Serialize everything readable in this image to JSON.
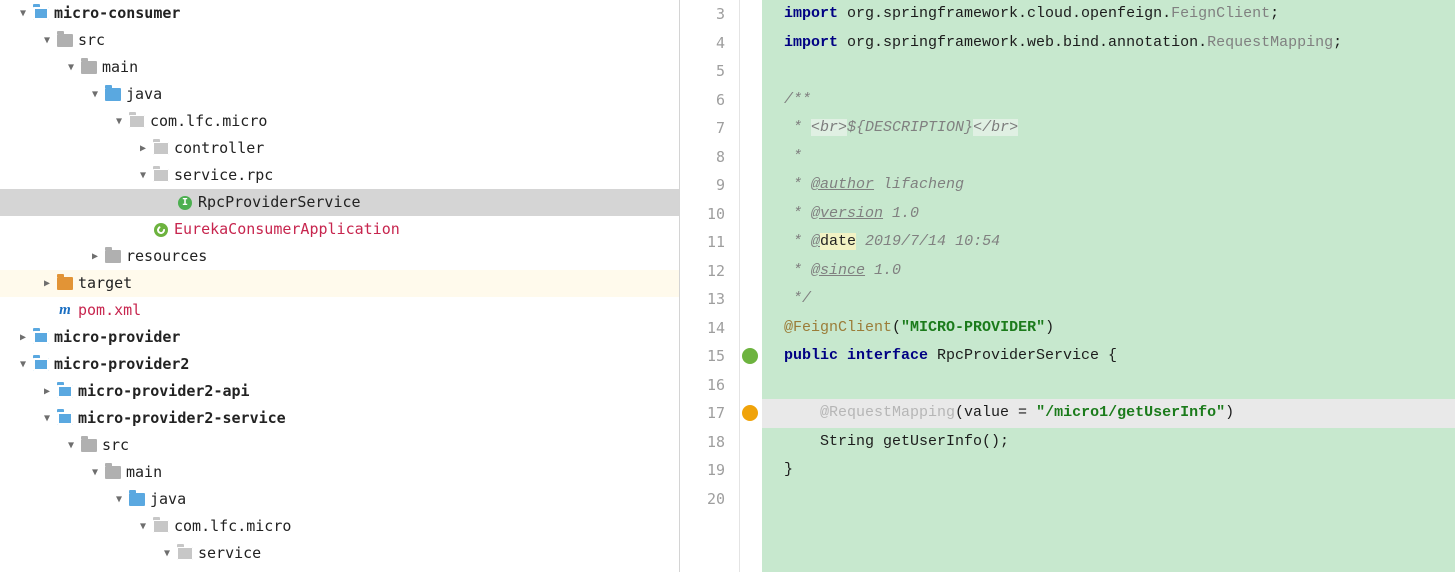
{
  "tree": {
    "root": [
      {
        "id": "micro-consumer",
        "indent": 0,
        "arrow": "down",
        "icon": "module",
        "label": "micro-consumer",
        "bold": true
      },
      {
        "id": "src",
        "indent": 1,
        "arrow": "down",
        "icon": "folder",
        "label": "src"
      },
      {
        "id": "main",
        "indent": 2,
        "arrow": "down",
        "icon": "folder",
        "label": "main"
      },
      {
        "id": "java",
        "indent": 3,
        "arrow": "down",
        "icon": "folder-blue",
        "label": "java"
      },
      {
        "id": "com-lfc-micro",
        "indent": 4,
        "arrow": "down",
        "icon": "pkg",
        "label": "com.lfc.micro"
      },
      {
        "id": "controller",
        "indent": 5,
        "arrow": "right",
        "icon": "pkg",
        "label": "controller"
      },
      {
        "id": "service-rpc",
        "indent": 5,
        "arrow": "down",
        "icon": "pkg",
        "label": "service.rpc"
      },
      {
        "id": "RpcProviderService",
        "indent": 6,
        "arrow": "",
        "icon": "interface",
        "label": "RpcProviderService",
        "selected": true
      },
      {
        "id": "EurekaConsumerApplication",
        "indent": 5,
        "arrow": "",
        "icon": "spring",
        "label": "EurekaConsumerApplication",
        "red": true
      },
      {
        "id": "resources",
        "indent": 3,
        "arrow": "right",
        "icon": "folder",
        "label": "resources"
      },
      {
        "id": "target",
        "indent": 1,
        "arrow": "right",
        "icon": "folder-orange",
        "label": "target",
        "highlighted": true
      },
      {
        "id": "pom-xml",
        "indent": 1,
        "arrow": "",
        "icon": "maven",
        "label": "pom.xml",
        "red": true
      },
      {
        "id": "micro-provider",
        "indent": 0,
        "arrow": "right",
        "icon": "module",
        "label": "micro-provider",
        "bold": true
      },
      {
        "id": "micro-provider2",
        "indent": 0,
        "arrow": "down",
        "icon": "module",
        "label": "micro-provider2",
        "bold": true
      },
      {
        "id": "micro-provider2-api",
        "indent": 1,
        "arrow": "right",
        "icon": "module",
        "label": "micro-provider2-api",
        "bold": true
      },
      {
        "id": "micro-provider2-service",
        "indent": 1,
        "arrow": "down",
        "icon": "module",
        "label": "micro-provider2-service",
        "bold": true
      },
      {
        "id": "src2",
        "indent": 2,
        "arrow": "down",
        "icon": "folder",
        "label": "src"
      },
      {
        "id": "main2",
        "indent": 3,
        "arrow": "down",
        "icon": "folder",
        "label": "main"
      },
      {
        "id": "java2",
        "indent": 4,
        "arrow": "down",
        "icon": "folder-blue",
        "label": "java"
      },
      {
        "id": "com-lfc-micro2",
        "indent": 5,
        "arrow": "down",
        "icon": "pkg",
        "label": "com.lfc.micro"
      },
      {
        "id": "service2",
        "indent": 6,
        "arrow": "down",
        "icon": "pkg",
        "label": "service"
      }
    ]
  },
  "editor": {
    "first_line_number": 3,
    "line_count": 18,
    "caret_line": 17,
    "gutter_markers": [
      {
        "line": 15,
        "kind": "green"
      },
      {
        "line": 17,
        "kind": "bulb"
      }
    ],
    "code_tokens": {
      "3": [
        [
          "kw",
          "import"
        ],
        [
          "plain",
          " org.springframework.cloud.openfeign."
        ],
        [
          "pkg-dim",
          "FeignClient"
        ],
        [
          "plain",
          ";"
        ]
      ],
      "4": [
        [
          "kw",
          "import"
        ],
        [
          "plain",
          " org.springframework.web.bind.annotation."
        ],
        [
          "pkg-dim",
          "RequestMapping"
        ],
        [
          "plain",
          ";"
        ]
      ],
      "5": [],
      "6": [
        [
          "jdoc",
          "/**"
        ]
      ],
      "7": [
        [
          "jdoc",
          " * "
        ],
        [
          "jdoc-html",
          "<br>"
        ],
        [
          "jdoc",
          "${DESCRIPTION}"
        ],
        [
          "jdoc-html",
          "</br>"
        ]
      ],
      "8": [
        [
          "jdoc",
          " *"
        ]
      ],
      "9": [
        [
          "jdoc",
          " * "
        ],
        [
          "jdoc-tag",
          "@author"
        ],
        [
          "jdoc",
          " lifacheng"
        ]
      ],
      "10": [
        [
          "jdoc",
          " * "
        ],
        [
          "jdoc-tag",
          "@version"
        ],
        [
          "jdoc",
          " 1.0"
        ]
      ],
      "11": [
        [
          "jdoc",
          " * "
        ],
        [
          "jdoc-tag",
          "@"
        ],
        [
          "hl-date",
          "date"
        ],
        [
          "jdoc",
          " 2019/7/14 10:54"
        ]
      ],
      "12": [
        [
          "jdoc",
          " * "
        ],
        [
          "jdoc-tag",
          "@since"
        ],
        [
          "jdoc",
          " 1.0"
        ]
      ],
      "13": [
        [
          "jdoc",
          " */"
        ]
      ],
      "14": [
        [
          "ann",
          "@FeignClient"
        ],
        [
          "plain",
          "("
        ],
        [
          "str",
          "\"MICRO-PROVIDER\""
        ],
        [
          "plain",
          ")"
        ]
      ],
      "15": [
        [
          "kw",
          "public interface"
        ],
        [
          "plain",
          " RpcProviderService {"
        ]
      ],
      "16": [],
      "17": [
        [
          "plain",
          "    "
        ],
        [
          "ann-dim",
          "@RequestMapping"
        ],
        [
          "plain",
          "(value = "
        ],
        [
          "str",
          "\"/micro1/getUserInfo\""
        ],
        [
          "plain",
          ")"
        ]
      ],
      "18": [
        [
          "plain",
          "    String getUserInfo();"
        ]
      ],
      "19": [
        [
          "plain",
          "}"
        ]
      ],
      "20": []
    }
  }
}
